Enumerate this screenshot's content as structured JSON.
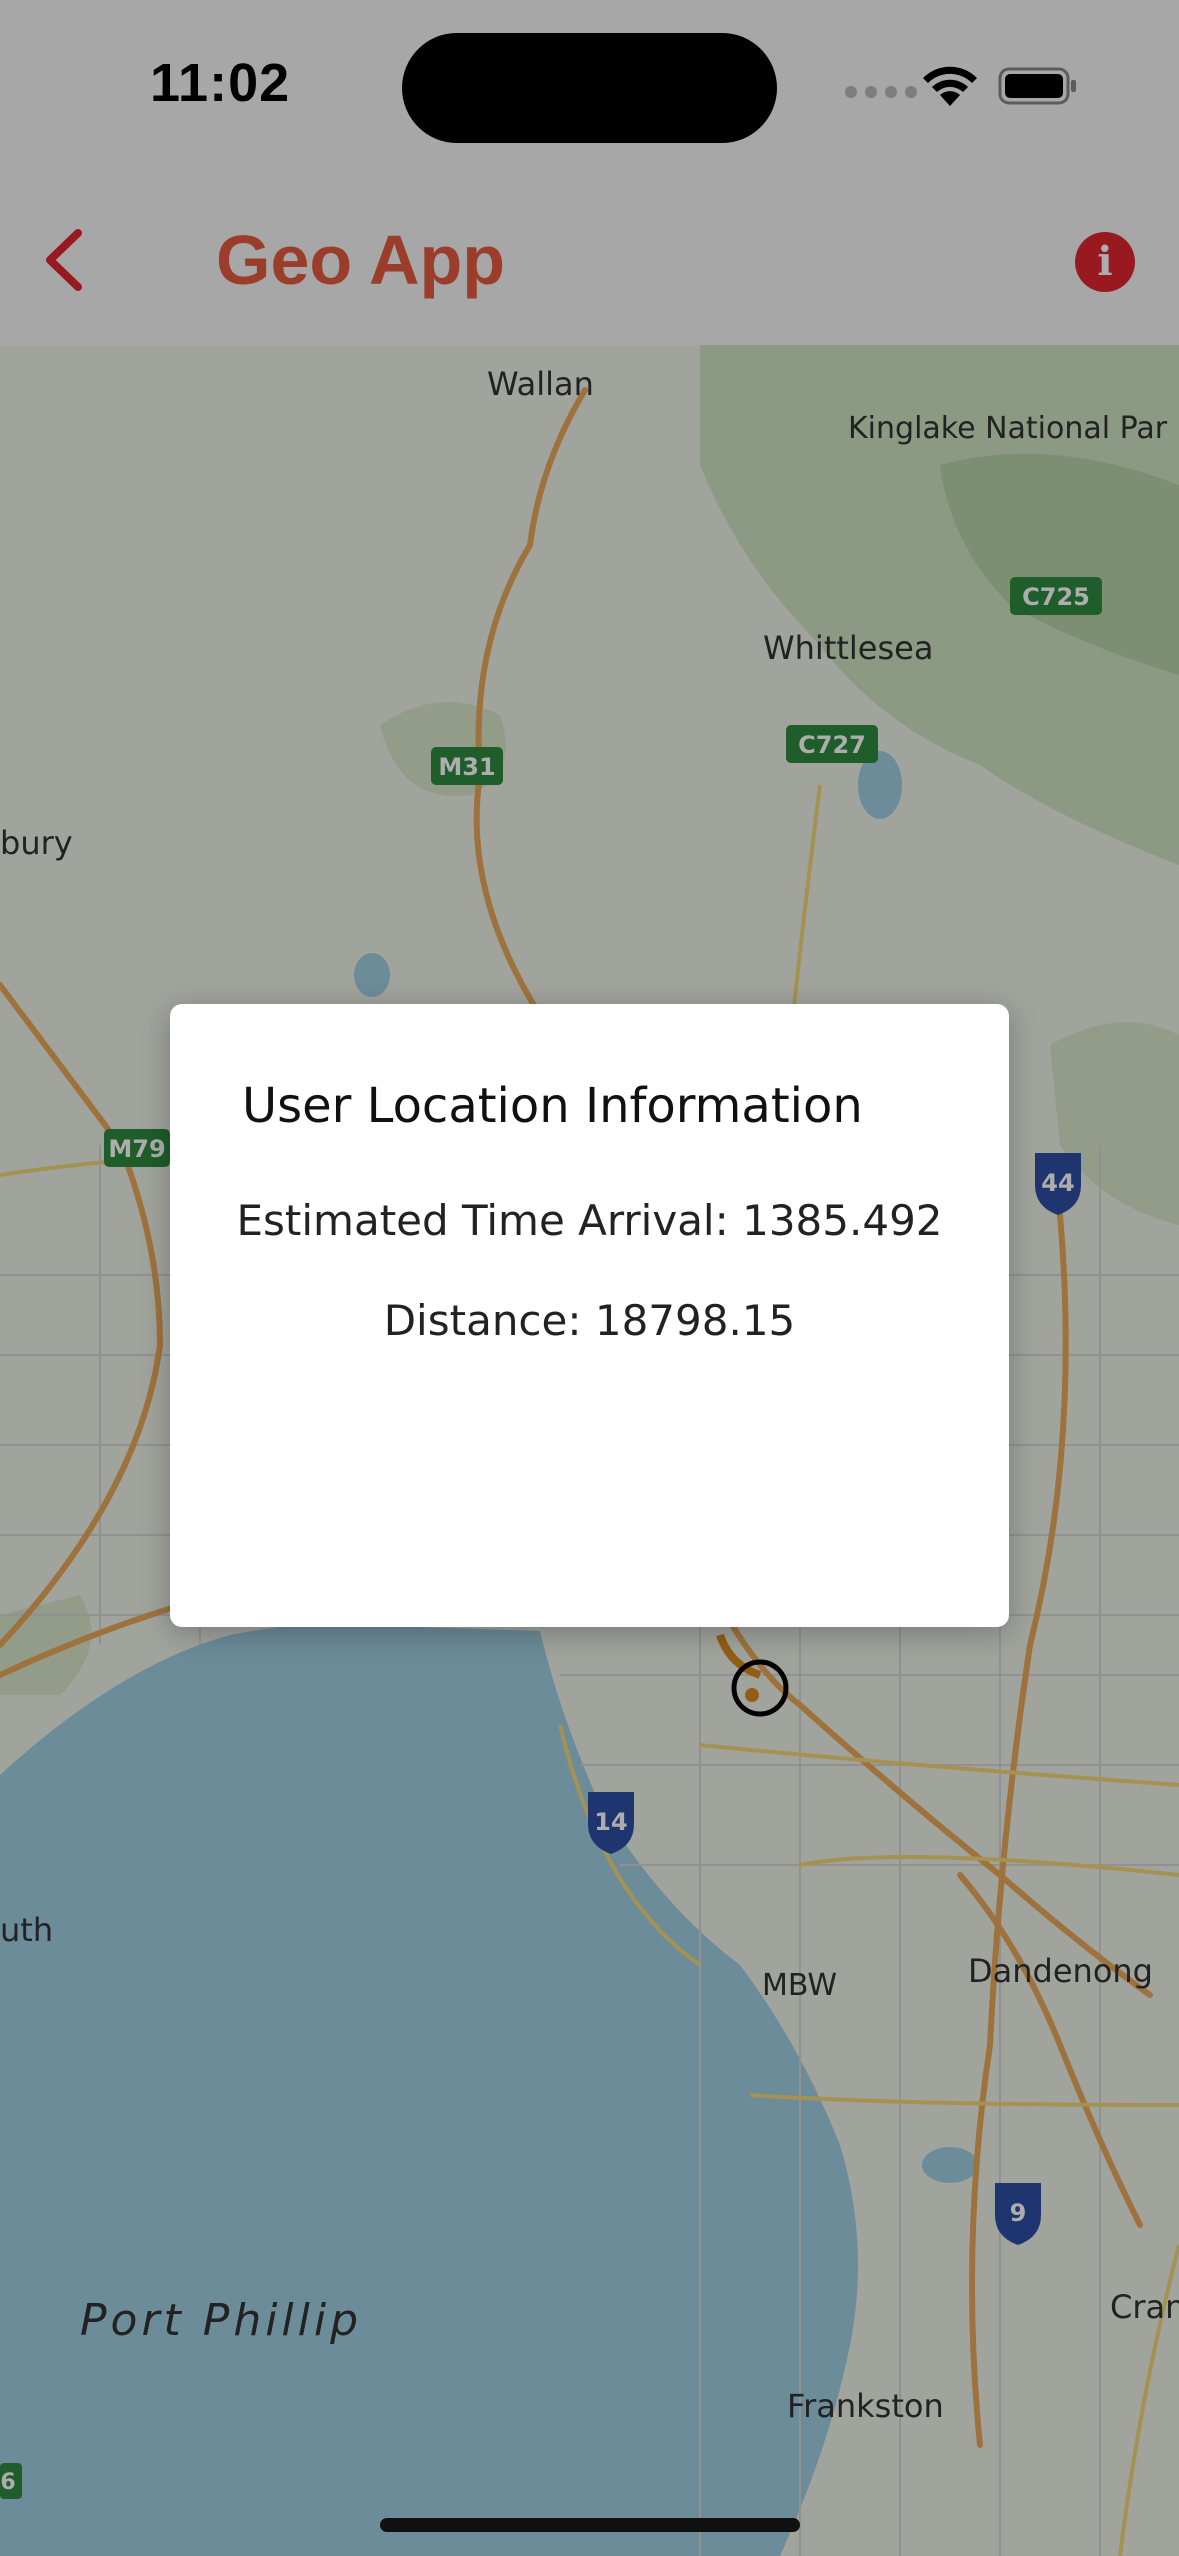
{
  "status_bar": {
    "time": "11:02"
  },
  "nav": {
    "title": "Geo App",
    "back_icon": "chevron-left-icon",
    "info_icon": "info-icon",
    "accent": "#e45b3e"
  },
  "map": {
    "labels": {
      "wallan": "Wallan",
      "kinglake": "Kinglake National Par",
      "whittlesea": "Whittlesea",
      "bury": "bury",
      "uth": "uth",
      "dandenong": "Dandenong",
      "mbw": "MBW",
      "port_phillip": "Port Phillip",
      "frankston": "Frankston",
      "cran": "Cran"
    },
    "shields": {
      "c725": "C725",
      "c727": "C727",
      "m31": "M31",
      "m79": "M79",
      "r44": "44",
      "r14": "14",
      "r9": "9",
      "r6": "6"
    }
  },
  "dialog": {
    "title": "User Location Information",
    "eta": "Estimated Time Arrival: 1385.492",
    "distance": "Distance: 18798.15"
  }
}
